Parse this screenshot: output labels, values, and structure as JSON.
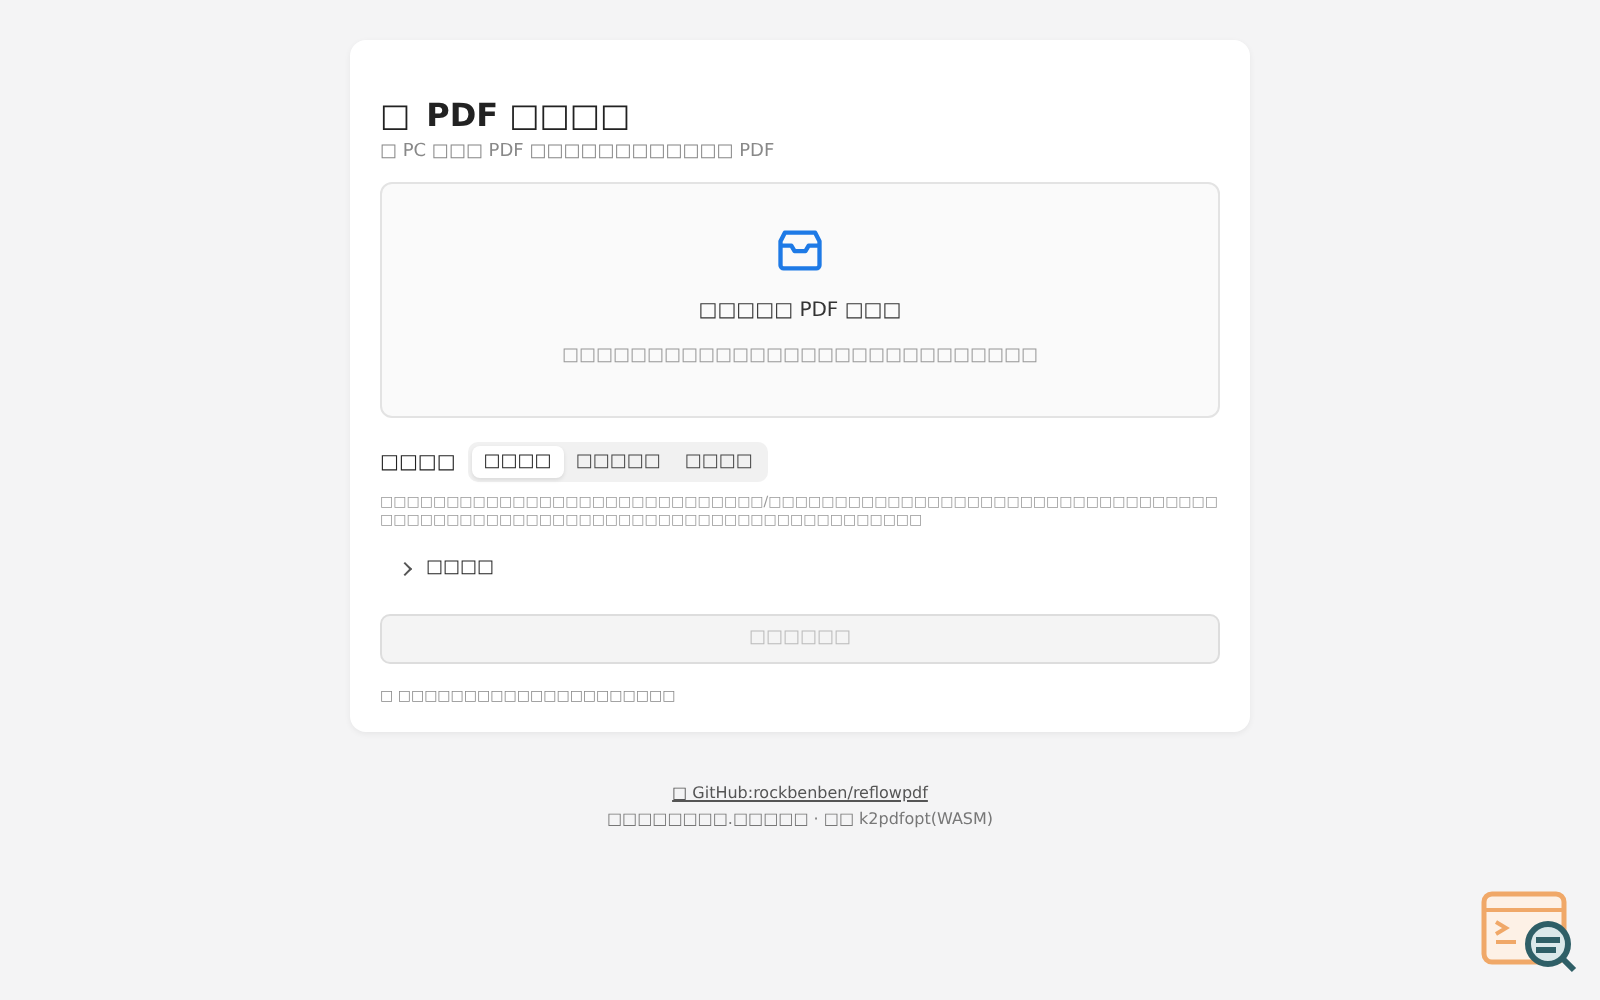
{
  "header": {
    "icon": "□",
    "title": "PDF □□□□",
    "subtitle": "□ PC □□□ PDF □□□□□□□□□□□□ PDF"
  },
  "dropzone": {
    "title": "□□□□□ PDF □□□",
    "hint": "□□□□□□□□□□□□□□□□□□□□□□□□□□□□"
  },
  "mode": {
    "label": "□□□□",
    "tabs": [
      {
        "label": "□□□□",
        "selected": true
      },
      {
        "label": "□□□□□",
        "selected": false
      },
      {
        "label": "□□□□",
        "selected": false
      }
    ],
    "description": "□□□□□□□□□□□□□□□□□□□□□□□□□□□□□/□□□□□□□□□□□□□□□□□□□□□□□□□□□□□□□□□□□□□□□□□□□□□□□□□□□□□□□□□□□□□□□□□□□□□□□□□□□"
  },
  "advanced": {
    "label": "□□□□",
    "expanded": false
  },
  "submit": {
    "label": "□□□□□□",
    "disabled": true
  },
  "note": "□ □□□□□□□□□□□□□□□□□□□□□",
  "footer": {
    "link": "□ GitHub:rockbenben/reflowpdf",
    "credit": "□□□□□□□□.□□□□□ · □□ k2pdfopt(WASM)"
  }
}
